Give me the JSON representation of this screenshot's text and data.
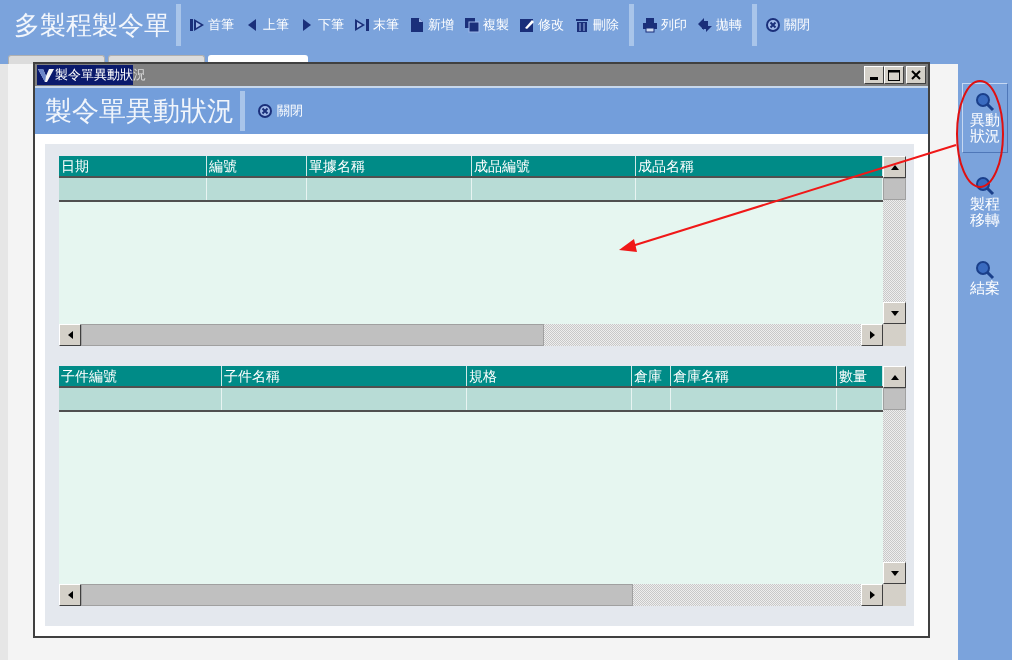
{
  "app_title": "多製程製令單",
  "toolbar_groups": [
    [
      {
        "label": "首筆"
      },
      {
        "label": "上筆"
      },
      {
        "label": "下筆"
      },
      {
        "label": "末筆"
      },
      {
        "label": "新增"
      },
      {
        "label": "複製"
      },
      {
        "label": "修改"
      },
      {
        "label": "刪除"
      }
    ],
    [
      {
        "label": "列印"
      },
      {
        "label": "拋轉"
      }
    ],
    [
      {
        "label": "關閉"
      }
    ]
  ],
  "tabs": [
    {
      "selected": false
    },
    {
      "selected": false
    },
    {
      "selected": true
    }
  ],
  "sidebar": {
    "items": [
      {
        "label": "異動狀況",
        "selected": true
      },
      {
        "label": "製程移轉",
        "selected": false
      },
      {
        "label": "結案",
        "selected": false
      }
    ]
  },
  "dialog": {
    "title_parts": [
      {
        "text": "製令單異動狀",
        "selected": true
      },
      {
        "text": "況",
        "selected": false
      }
    ],
    "heading": "製令單異動狀況",
    "close_button": "關閉",
    "grids": [
      {
        "columns": [
          "日期",
          "編號",
          "單據名稱",
          "成品編號",
          "成品名稱"
        ]
      },
      {
        "columns": [
          "子件編號",
          "子件名稱",
          "規格",
          "倉庫",
          "倉庫名稱",
          "數量"
        ]
      }
    ]
  }
}
